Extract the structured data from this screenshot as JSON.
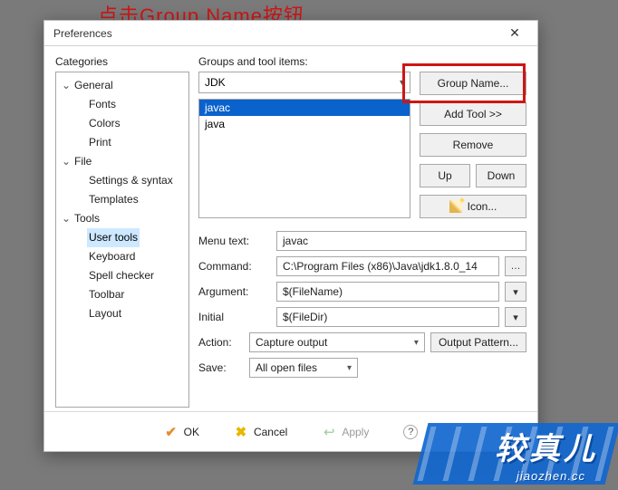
{
  "annotation": {
    "text": "点击Group Name按钮"
  },
  "dialog": {
    "title": "Preferences"
  },
  "categories": {
    "label": "Categories",
    "tree": [
      {
        "label": "General",
        "expanded": true,
        "children": [
          {
            "label": "Fonts"
          },
          {
            "label": "Colors"
          },
          {
            "label": "Print"
          }
        ]
      },
      {
        "label": "File",
        "expanded": true,
        "children": [
          {
            "label": "Settings & syntax"
          },
          {
            "label": "Templates"
          }
        ]
      },
      {
        "label": "Tools",
        "expanded": true,
        "children": [
          {
            "label": "User tools",
            "selected": true
          },
          {
            "label": "Keyboard"
          },
          {
            "label": "Spell checker"
          },
          {
            "label": "Toolbar"
          },
          {
            "label": "Layout"
          }
        ]
      }
    ]
  },
  "groups": {
    "label": "Groups and tool items:",
    "selected_group": "JDK",
    "items": [
      {
        "label": "javac",
        "selected": true
      },
      {
        "label": "java",
        "selected": false
      }
    ]
  },
  "buttons": {
    "group_name": "Group Name...",
    "add_tool": "Add Tool >>",
    "remove": "Remove",
    "up": "Up",
    "down": "Down",
    "icon": "Icon..."
  },
  "form": {
    "menu_text": {
      "label": "Menu text:",
      "value": "javac"
    },
    "command": {
      "label": "Command:",
      "value": "C:\\Program Files (x86)\\Java\\jdk1.8.0_14"
    },
    "argument": {
      "label": "Argument:",
      "value": "$(FileName)"
    },
    "initial": {
      "label": "Initial",
      "value": "$(FileDir)"
    },
    "action": {
      "label": "Action:",
      "value": "Capture output"
    },
    "output_pattern": "Output Pattern...",
    "save": {
      "label": "Save:",
      "value": "All open files"
    }
  },
  "footer": {
    "ok": "OK",
    "cancel": "Cancel",
    "apply": "Apply",
    "help": "?"
  },
  "watermark": {
    "main": "较真儿",
    "sub": "jiaozhen.cc"
  }
}
